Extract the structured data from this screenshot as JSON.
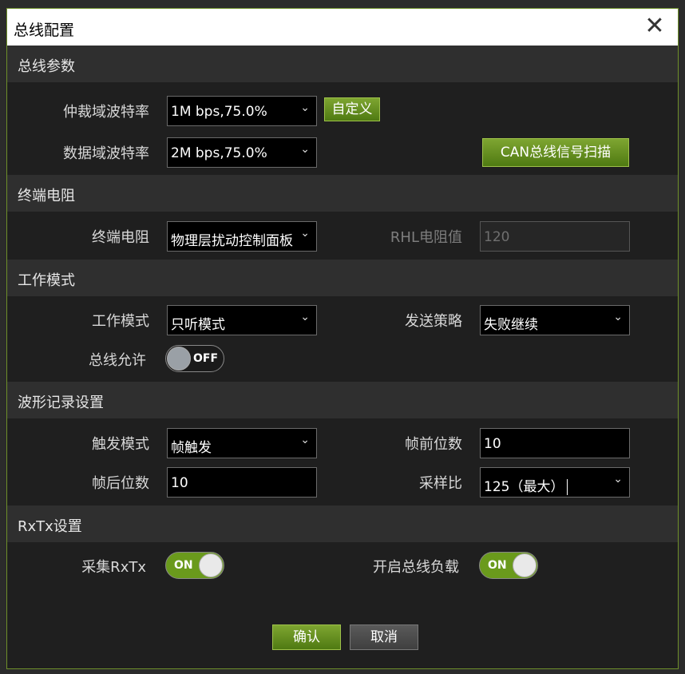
{
  "dialog": {
    "title": "总线配置",
    "close_glyph": "✕"
  },
  "sections": {
    "bus_params": "总线参数",
    "termination": "终端电阻",
    "work_mode": "工作模式",
    "waveform": "波形记录设置",
    "rxtx": "RxTx设置"
  },
  "bus_params": {
    "arb_rate_label": "仲裁域波特率",
    "arb_rate_value": "1M bps,75.0%",
    "custom_button": "自定义",
    "data_rate_label": "数据域波特率",
    "data_rate_value": "2M bps,75.0%",
    "scan_button": "CAN总线信号扫描"
  },
  "termination": {
    "label": "终端电阻",
    "value": "物理层扰动控制面板",
    "rhl_label": "RHL电阻值",
    "rhl_value": "120"
  },
  "work_mode": {
    "mode_label": "工作模式",
    "mode_value": "只听模式",
    "strategy_label": "发送策略",
    "strategy_value": "失败继续",
    "bus_allow_label": "总线允许",
    "bus_allow_state": "OFF"
  },
  "waveform": {
    "trigger_label": "触发模式",
    "trigger_value": "帧触发",
    "pre_bits_label": "帧前位数",
    "pre_bits_value": "10",
    "post_bits_label": "帧后位数",
    "post_bits_value": "10",
    "sample_label": "采样比",
    "sample_value": "125（最大）"
  },
  "rxtx": {
    "collect_label": "采集RxTx",
    "collect_state": "ON",
    "load_label": "开启总线负载",
    "load_state": "ON"
  },
  "footer": {
    "confirm": "确认",
    "cancel": "取消"
  },
  "icons": {
    "chevron": "⌄"
  }
}
